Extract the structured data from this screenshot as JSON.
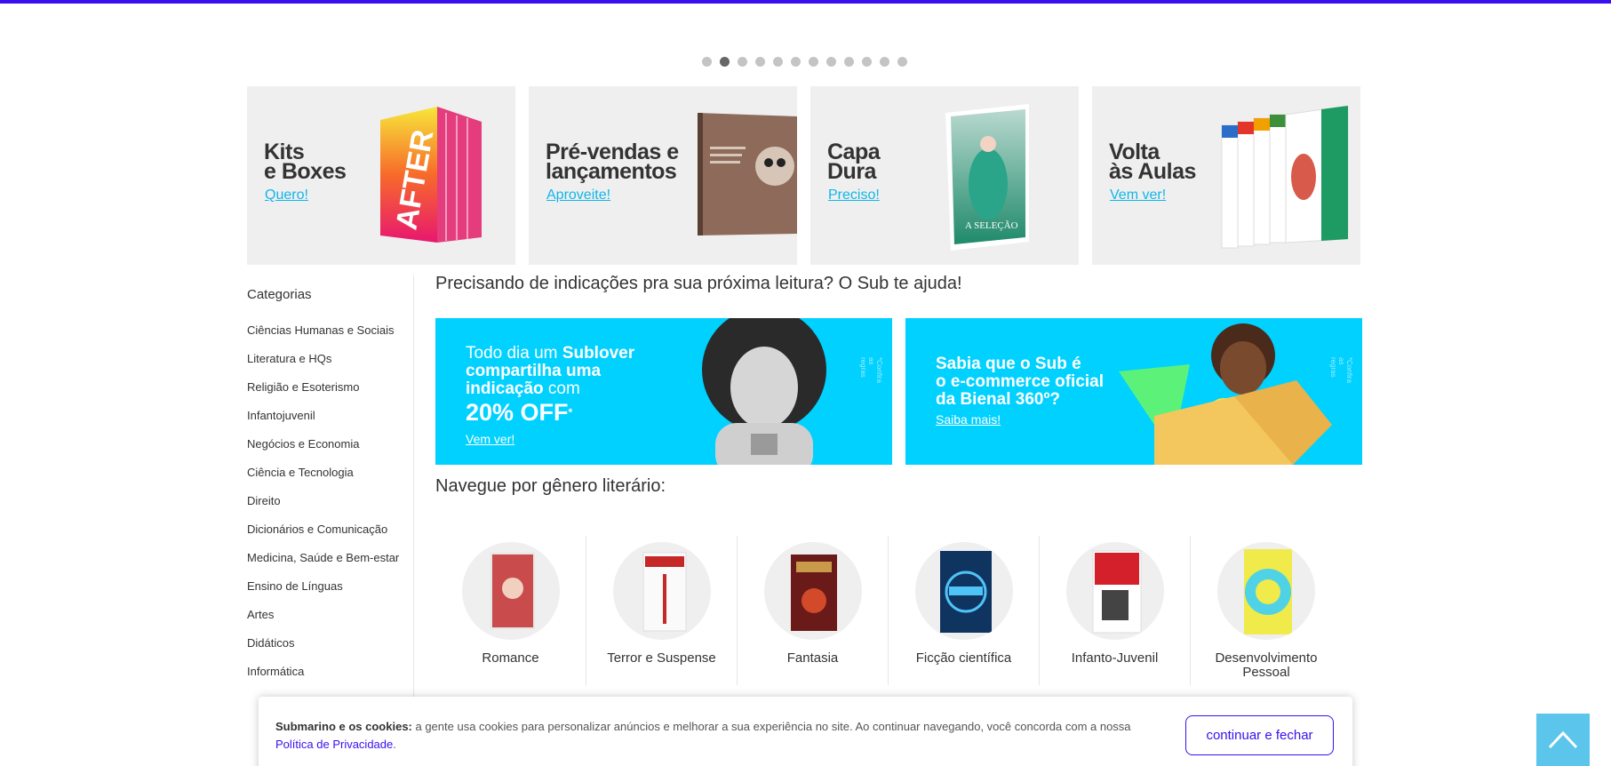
{
  "carousel": {
    "dot_count": 12,
    "active_index": 1
  },
  "banners": [
    {
      "title": "Kits\ne Boxes",
      "cta": "Quero!",
      "icon": "book-box-after-icon"
    },
    {
      "title": "Pré-vendas e\nlançamentos",
      "cta": "Aproveite!",
      "icon": "book-preorder-icon"
    },
    {
      "title": "Capa\nDura",
      "cta": "Preciso!",
      "icon": "book-hardcover-icon"
    },
    {
      "title": "Volta\nàs Aulas",
      "cta": "Vem ver!",
      "icon": "book-school-icon"
    }
  ],
  "sidebar": {
    "title": "Categorias",
    "items": [
      "Ciências Humanas e Sociais",
      "Literatura e HQs",
      "Religião e Esoterismo",
      "Infantojuvenil",
      "Negócios e Economia",
      "Ciência e Tecnologia",
      "Direito",
      "Dicionários e Comunicação",
      "Medicina, Saúde e Bem-estar",
      "Ensino de Línguas",
      "Artes",
      "Didáticos",
      "Informática"
    ]
  },
  "main": {
    "heading": "Precisando de indicações pra sua próxima leitura? O Sub te ajuda!",
    "promo1": {
      "line1_a": "Todo dia um ",
      "line1_b": "Sublover",
      "line2": "compartilha uma",
      "line3_a": "indicação",
      "line3_b": " com",
      "discount": "20% OFF",
      "star": "*",
      "cta": "Vem ver!",
      "fine": "*Confira as regras"
    },
    "promo2": {
      "line1": "Sabia que o Sub é",
      "line2": "o e-commerce oficial",
      "line3": "da Bienal 360º?",
      "cta": "Saiba mais!",
      "fine": "*Confira as regras"
    },
    "genre_heading": "Navegue por gênero literário:",
    "genres": [
      {
        "name": "Romance",
        "color": "#d98a8a"
      },
      {
        "name": "Terror e Suspense",
        "color": "#f4f4f4"
      },
      {
        "name": "Fantasia",
        "color": "#7a1f1f"
      },
      {
        "name": "Ficção científica",
        "color": "#123a6b"
      },
      {
        "name": "Infanto-Juvenil",
        "color": "#d4202a"
      },
      {
        "name": "Desenvolvimento\nPessoal",
        "color": "#e7e54a"
      }
    ]
  },
  "cookie": {
    "bold": "Submarino e os cookies:",
    "text": " a gente usa cookies para personalizar anúncios e melhorar a sua experiência no site. Ao continuar navegando, você concorda com a nossa",
    "link": "Política de Privacidade",
    "end": ".",
    "button": "continuar e fechar"
  },
  "colors": {
    "accent": "#3a0ff0",
    "cyan": "#00d1ff",
    "link": "#11b6ea"
  },
  "back_to_top": {
    "icon": "chevron-up-icon"
  }
}
